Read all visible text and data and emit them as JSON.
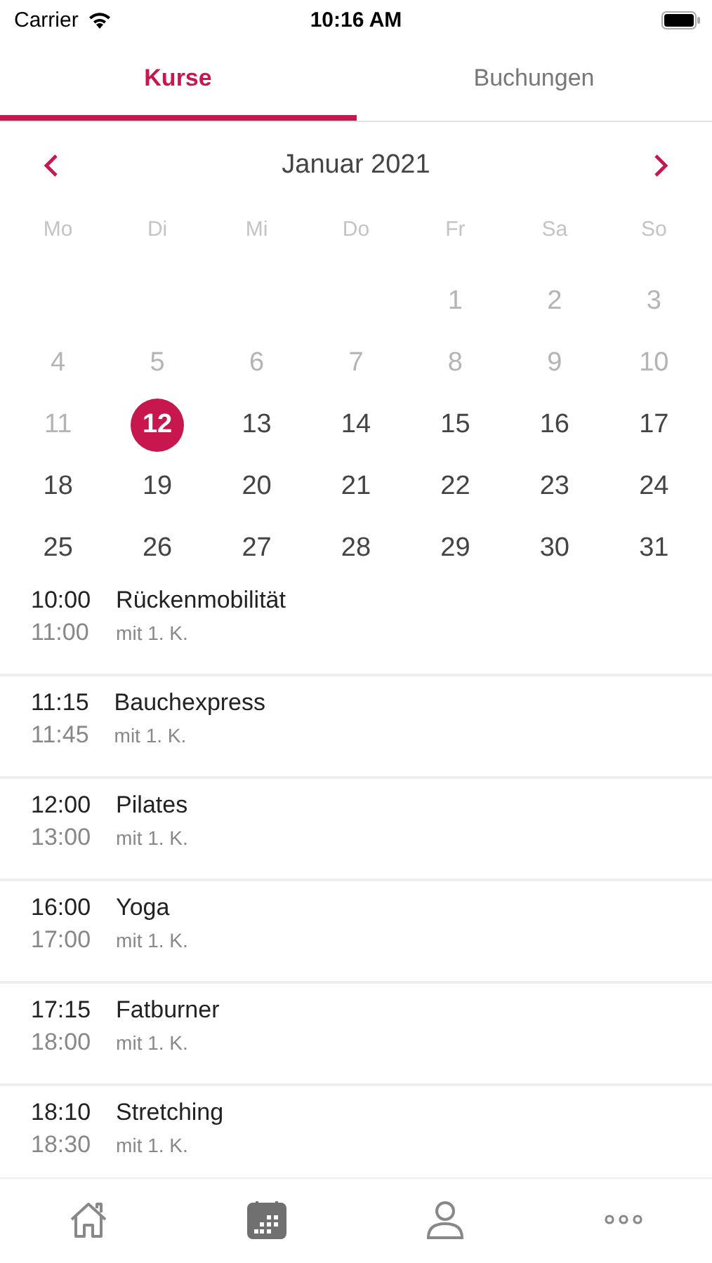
{
  "status_bar": {
    "carrier": "Carrier",
    "time": "10:16 AM"
  },
  "tabs": [
    {
      "label": "Kurse",
      "selected": true
    },
    {
      "label": "Buchungen",
      "selected": false
    }
  ],
  "calendar": {
    "month": "Januar 2021",
    "weekdays": [
      "Mo",
      "Di",
      "Mi",
      "Do",
      "Fr",
      "Sa",
      "So"
    ],
    "weeks": [
      [
        {
          "kind": "blank"
        },
        {
          "kind": "blank"
        },
        {
          "kind": "blank"
        },
        {
          "kind": "blank"
        },
        {
          "kind": "day",
          "label": "1",
          "disabled": true,
          "selected": false
        },
        {
          "kind": "day",
          "label": "2",
          "disabled": true,
          "selected": false
        },
        {
          "kind": "day",
          "label": "3",
          "disabled": true,
          "selected": false
        }
      ],
      [
        {
          "kind": "day",
          "label": "4",
          "disabled": true,
          "selected": false
        },
        {
          "kind": "day",
          "label": "5",
          "disabled": true,
          "selected": false
        },
        {
          "kind": "day",
          "label": "6",
          "disabled": true,
          "selected": false
        },
        {
          "kind": "day",
          "label": "7",
          "disabled": true,
          "selected": false
        },
        {
          "kind": "day",
          "label": "8",
          "disabled": true,
          "selected": false
        },
        {
          "kind": "day",
          "label": "9",
          "disabled": true,
          "selected": false
        },
        {
          "kind": "day",
          "label": "10",
          "disabled": true,
          "selected": false
        }
      ],
      [
        {
          "kind": "day",
          "label": "11",
          "disabled": true,
          "selected": false
        },
        {
          "kind": "day",
          "label": "12",
          "disabled": false,
          "selected": true
        },
        {
          "kind": "day",
          "label": "13",
          "disabled": false,
          "selected": false
        },
        {
          "kind": "day",
          "label": "14",
          "disabled": false,
          "selected": false
        },
        {
          "kind": "day",
          "label": "15",
          "disabled": false,
          "selected": false
        },
        {
          "kind": "day",
          "label": "16",
          "disabled": false,
          "selected": false
        },
        {
          "kind": "day",
          "label": "17",
          "disabled": false,
          "selected": false
        }
      ],
      [
        {
          "kind": "day",
          "label": "18",
          "disabled": false,
          "selected": false
        },
        {
          "kind": "day",
          "label": "19",
          "disabled": false,
          "selected": false
        },
        {
          "kind": "day",
          "label": "20",
          "disabled": false,
          "selected": false
        },
        {
          "kind": "day",
          "label": "21",
          "disabled": false,
          "selected": false
        },
        {
          "kind": "day",
          "label": "22",
          "disabled": false,
          "selected": false
        },
        {
          "kind": "day",
          "label": "23",
          "disabled": false,
          "selected": false
        },
        {
          "kind": "day",
          "label": "24",
          "disabled": false,
          "selected": false
        }
      ],
      [
        {
          "kind": "day",
          "label": "25",
          "disabled": false,
          "selected": false
        },
        {
          "kind": "day",
          "label": "26",
          "disabled": false,
          "selected": false
        },
        {
          "kind": "day",
          "label": "27",
          "disabled": false,
          "selected": false
        },
        {
          "kind": "day",
          "label": "28",
          "disabled": false,
          "selected": false
        },
        {
          "kind": "day",
          "label": "29",
          "disabled": false,
          "selected": false
        },
        {
          "kind": "day",
          "label": "30",
          "disabled": false,
          "selected": false
        },
        {
          "kind": "day",
          "label": "31",
          "disabled": false,
          "selected": false
        }
      ]
    ]
  },
  "courses": [
    {
      "start": "10:00",
      "end": "11:00",
      "title": "Rückenmobilität",
      "trainer": "mit 1. K."
    },
    {
      "start": "11:15",
      "end": "11:45",
      "title": "Bauchexpress",
      "trainer": "mit 1. K."
    },
    {
      "start": "12:00",
      "end": "13:00",
      "title": "Pilates",
      "trainer": "mit 1. K."
    },
    {
      "start": "16:00",
      "end": "17:00",
      "title": "Yoga",
      "trainer": "mit 1. K."
    },
    {
      "start": "17:15",
      "end": "18:00",
      "title": "Fatburner",
      "trainer": "mit 1. K."
    },
    {
      "start": "18:10",
      "end": "18:30",
      "title": "Stretching",
      "trainer": "mit 1. K."
    }
  ],
  "tab_bar": [
    {
      "kind": "home",
      "selected": false
    },
    {
      "kind": "calendar",
      "selected": true
    },
    {
      "kind": "profile",
      "selected": false
    },
    {
      "kind": "more",
      "selected": false
    }
  ]
}
